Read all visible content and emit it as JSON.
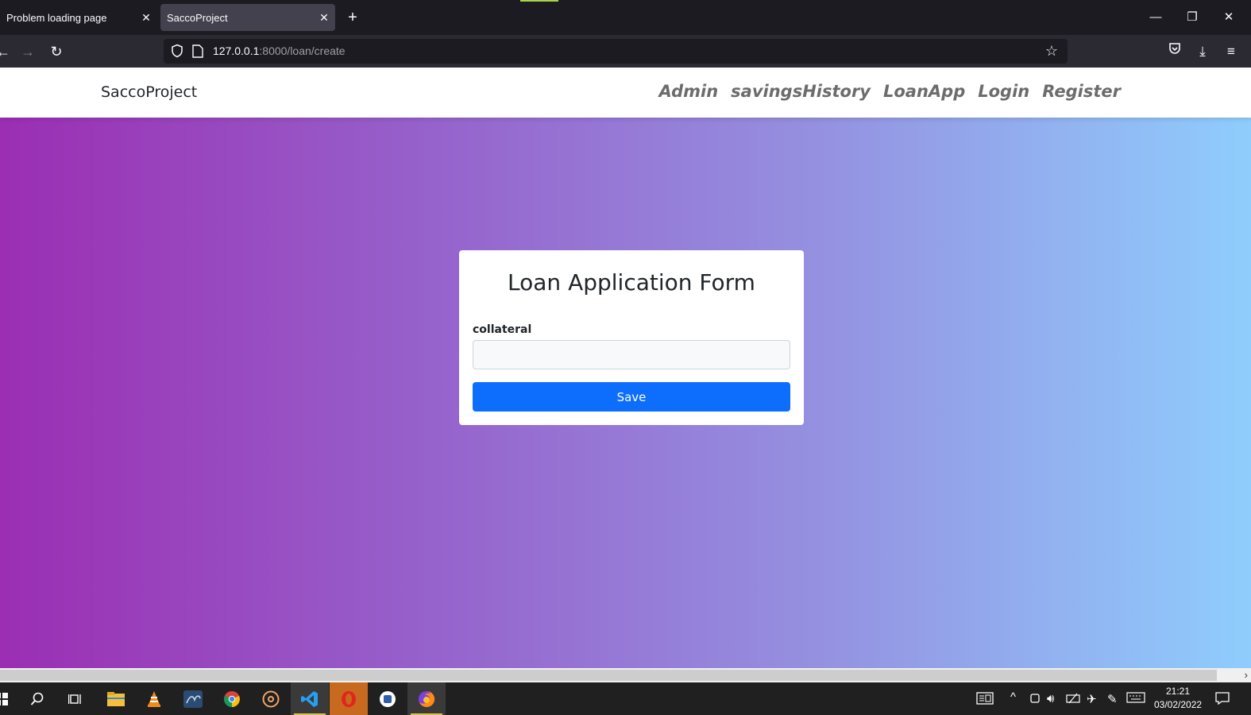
{
  "browser": {
    "tabs": [
      {
        "title": "Problem loading page",
        "active": false
      },
      {
        "title": "SaccoProject",
        "active": true
      }
    ],
    "url_host": "127.0.0.1",
    "url_rest": ":8000/loan/create"
  },
  "site": {
    "brand": "SaccoProject",
    "menu": [
      "Admin",
      "savingsHistory",
      "LoanApp",
      "Login",
      "Register"
    ]
  },
  "form": {
    "title": "Loan Application Form",
    "field_label": "collateral",
    "field_value": "",
    "submit_label": "Save"
  },
  "taskbar": {
    "time": "21:21",
    "date": "03/02/2022"
  },
  "colors": {
    "gradient_start": "#9b2eb3",
    "gradient_end": "#8fcdfd",
    "button": "#0d6efd"
  }
}
